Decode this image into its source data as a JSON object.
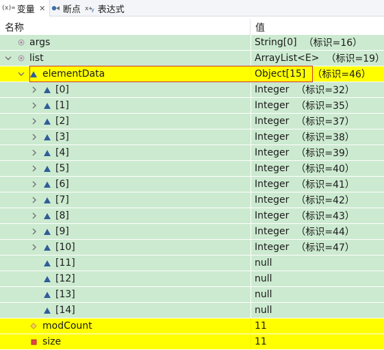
{
  "tabs": [
    {
      "label": "变量",
      "icon": "variables-icon",
      "active": true,
      "closable": true
    },
    {
      "label": "断点",
      "icon": "breakpoints-icon",
      "active": false
    },
    {
      "label": "表达式",
      "icon": "expressions-icon",
      "active": false
    }
  ],
  "columns": {
    "name": "名称",
    "value": "值"
  },
  "rows": [
    {
      "name": "args",
      "value": "String[0]",
      "id": "（标识=16）",
      "expander": "",
      "icon": "static-field-icon",
      "highlight": false
    },
    {
      "name": "list",
      "value": "ArrayList<E>",
      "id": "（标识=19）",
      "expander": "expanded",
      "icon": "static-field-icon",
      "highlight": false
    },
    {
      "name": "elementData",
      "value": "Object[15]",
      "id": "（标识=46）",
      "expander": "expanded",
      "icon": "array-element-icon",
      "highlight": true,
      "selected": true
    },
    {
      "name": "[0]",
      "value": "Integer",
      "id": "（标识=32）",
      "expander": "collapsed",
      "icon": "array-element-icon",
      "highlight": false
    },
    {
      "name": "[1]",
      "value": "Integer",
      "id": "（标识=35）",
      "expander": "collapsed",
      "icon": "array-element-icon",
      "highlight": false
    },
    {
      "name": "[2]",
      "value": "Integer",
      "id": "（标识=37）",
      "expander": "collapsed",
      "icon": "array-element-icon",
      "highlight": false
    },
    {
      "name": "[3]",
      "value": "Integer",
      "id": "（标识=38）",
      "expander": "collapsed",
      "icon": "array-element-icon",
      "highlight": false
    },
    {
      "name": "[4]",
      "value": "Integer",
      "id": "（标识=39）",
      "expander": "collapsed",
      "icon": "array-element-icon",
      "highlight": false
    },
    {
      "name": "[5]",
      "value": "Integer",
      "id": "（标识=40）",
      "expander": "collapsed",
      "icon": "array-element-icon",
      "highlight": false
    },
    {
      "name": "[6]",
      "value": "Integer",
      "id": "（标识=41）",
      "expander": "collapsed",
      "icon": "array-element-icon",
      "highlight": false
    },
    {
      "name": "[7]",
      "value": "Integer",
      "id": "（标识=42）",
      "expander": "collapsed",
      "icon": "array-element-icon",
      "highlight": false
    },
    {
      "name": "[8]",
      "value": "Integer",
      "id": "（标识=43）",
      "expander": "collapsed",
      "icon": "array-element-icon",
      "highlight": false
    },
    {
      "name": "[9]",
      "value": "Integer",
      "id": "（标识=44）",
      "expander": "collapsed",
      "icon": "array-element-icon",
      "highlight": false
    },
    {
      "name": "[10]",
      "value": "Integer",
      "id": "（标识=47）",
      "expander": "collapsed",
      "icon": "array-element-icon",
      "highlight": false
    },
    {
      "name": "[11]",
      "value": "null",
      "id": "",
      "expander": "",
      "icon": "array-element-icon",
      "highlight": false
    },
    {
      "name": "[12]",
      "value": "null",
      "id": "",
      "expander": "",
      "icon": "array-element-icon",
      "highlight": false
    },
    {
      "name": "[13]",
      "value": "null",
      "id": "",
      "expander": "",
      "icon": "array-element-icon",
      "highlight": false
    },
    {
      "name": "[14]",
      "value": "null",
      "id": "",
      "expander": "",
      "icon": "array-element-icon",
      "highlight": false
    },
    {
      "name": "modCount",
      "value": "11",
      "id": "",
      "expander": "",
      "icon": "protected-field-icon",
      "highlight": true
    },
    {
      "name": "size",
      "value": "11",
      "id": "",
      "expander": "",
      "icon": "private-field-icon",
      "highlight": true
    }
  ],
  "colors": {
    "row_background": "#ccead0",
    "changed_highlight": "#ffff00",
    "selection_border": "#d0303c",
    "array_icon": "#2f5e97"
  }
}
